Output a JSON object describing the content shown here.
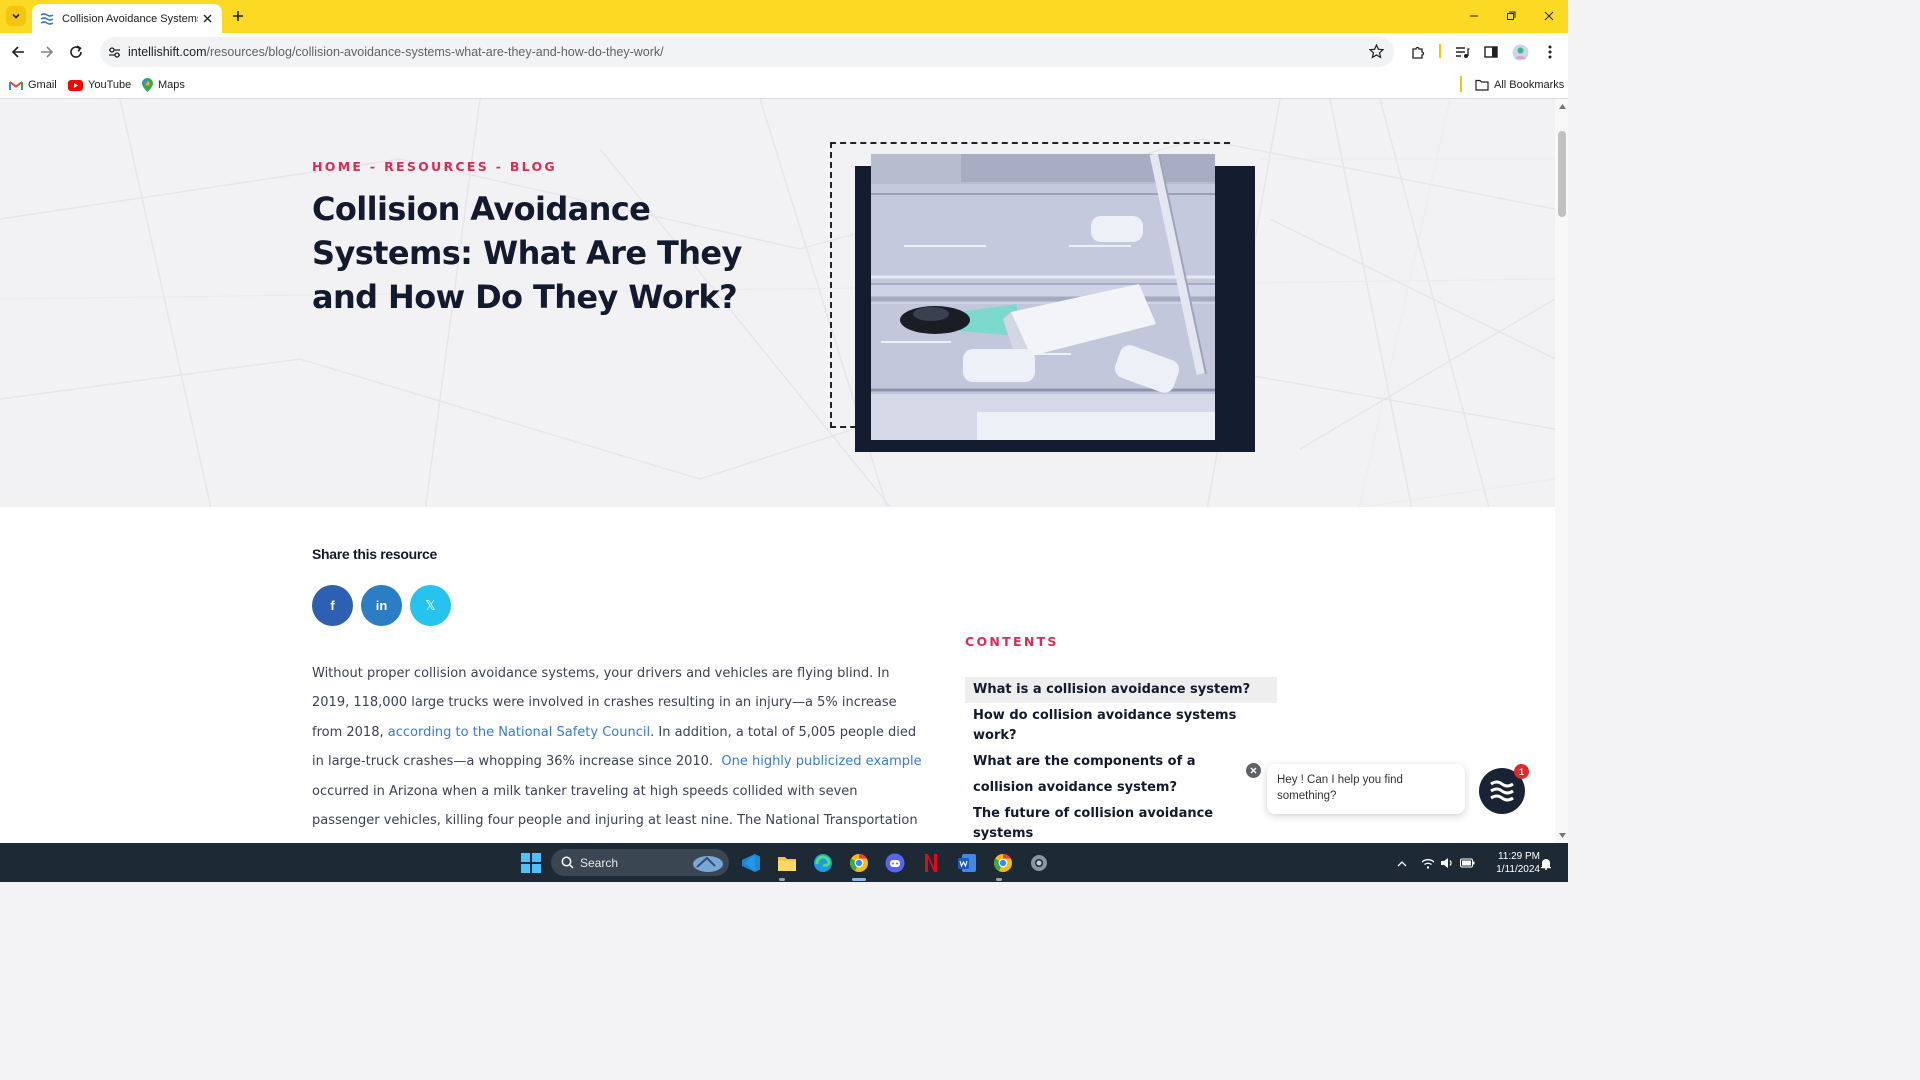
{
  "browser": {
    "tab_title": "Collision Avoidance Systems: W",
    "url_host": "intellishift.com",
    "url_path": "/resources/blog/collision-avoidance-systems-what-are-they-and-how-do-they-work/",
    "bookmarks": [
      {
        "label": "Gmail",
        "icon": "gmail-icon"
      },
      {
        "label": "YouTube",
        "icon": "youtube-icon"
      },
      {
        "label": "Maps",
        "icon": "maps-icon"
      }
    ],
    "all_bookmarks_label": "All Bookmarks"
  },
  "hero": {
    "breadcrumb": [
      "HOME",
      "RESOURCES",
      "BLOG"
    ],
    "breadcrumb_sep": " - ",
    "title": "Collision Avoidance Systems: What Are They and How Do They Work?"
  },
  "share": {
    "title": "Share this resource",
    "buttons": [
      {
        "label": "f",
        "network": "facebook",
        "color": "#2d5fb3"
      },
      {
        "label": "in",
        "network": "linkedin",
        "color": "#2b7dc4"
      },
      {
        "label": "𝕏",
        "network": "x",
        "color": "#27c3ef"
      }
    ]
  },
  "article": {
    "p1_a": "Without proper collision avoidance systems, your drivers and vehicles are flying blind. In 2019, 118,000 large trucks were involved in crashes resulting in an injury—a 5% increase from 2018, ",
    "p1_link1": "according to the National Safety Council",
    "p1_b": ". In addition, a total of 5,005 people died in large-truck crashes—a whopping 36% increase since 2010.  ",
    "p1_link2": "One highly publicized example",
    "p1_c": " occurred in Arizona when a milk tanker traveling at high speeds collided with seven passenger vehicles, killing four people and injuring at least nine. The National Transportation Safety Board (NTSB) will"
  },
  "contents": {
    "title": "CONTENTS",
    "items": [
      "What is a collision avoidance system?",
      "How do collision avoidance systems work?",
      "What are the components of a collision avoidance system?",
      "The future of collision avoidance systems"
    ]
  },
  "chat": {
    "message": "Hey ! Can I help you find something?",
    "badge": "1"
  },
  "taskbar": {
    "search_label": "Search",
    "time": "11:29 PM",
    "date": "1/11/2024"
  },
  "colors": {
    "accent_pink": "#e02a52",
    "heading_navy": "#141a2e",
    "chrome_yellow": "#fcd923",
    "link_blue": "#3a7bd5"
  }
}
